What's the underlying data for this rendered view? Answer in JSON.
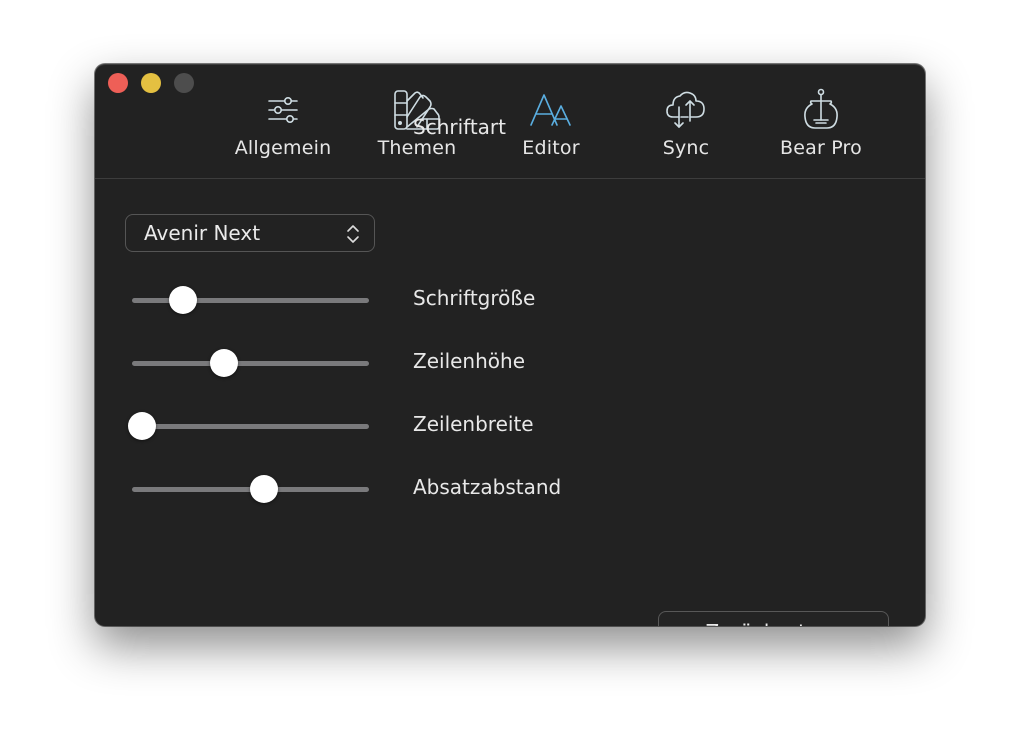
{
  "window": {
    "traffic_lights": [
      {
        "name": "close",
        "color": "#ee5f57"
      },
      {
        "name": "minimize",
        "color": "#e4c041"
      },
      {
        "name": "zoom",
        "color": "#4d4d4d"
      }
    ]
  },
  "toolbar": {
    "active_tab": "editor",
    "accent_color": "#5aaee0",
    "tabs": [
      {
        "id": "allgemein",
        "label": "Allgemein",
        "icon": "sliders-icon"
      },
      {
        "id": "themen",
        "label": "Themen",
        "icon": "color-swatch-fan-icon"
      },
      {
        "id": "editor",
        "label": "Editor",
        "icon": "font-aa-icon"
      },
      {
        "id": "sync",
        "label": "Sync",
        "icon": "cloud-sync-icon"
      },
      {
        "id": "bearpro",
        "label": "Bear Pro",
        "icon": "honey-pot-icon"
      }
    ]
  },
  "editor": {
    "font": {
      "selected": "Avenir Next",
      "label": "Schriftart"
    },
    "sliders": [
      {
        "label": "Schriftgröße",
        "value": 0.19
      },
      {
        "label": "Zeilenhöhe",
        "value": 0.38
      },
      {
        "label": "Zeilenbreite",
        "value": 0.0
      },
      {
        "label": "Absatzabstand",
        "value": 0.56
      }
    ],
    "reset_label": "Zurücksetzen"
  }
}
